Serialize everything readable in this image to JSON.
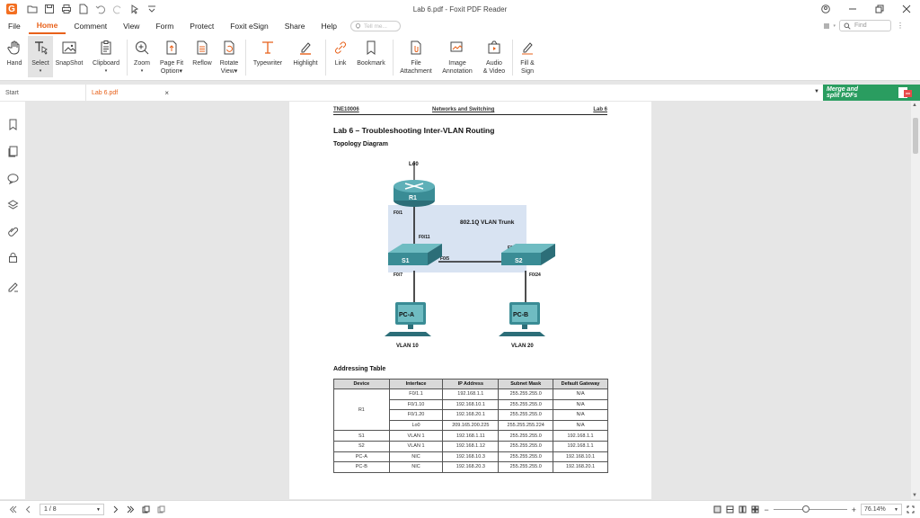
{
  "window": {
    "title": "Lab 6.pdf - Foxit PDF Reader",
    "logo_letter": "G"
  },
  "menu": {
    "items": [
      "File",
      "Home",
      "Comment",
      "View",
      "Form",
      "Protect",
      "Foxit eSign",
      "Share",
      "Help"
    ],
    "active": "Home",
    "tell_me_placeholder": "Tell me...",
    "find_placeholder": "Find"
  },
  "ribbon": {
    "hand": "Hand",
    "select": "Select",
    "snapshot": "SnapShot",
    "clipboard": "Clipboard",
    "zoom": "Zoom",
    "page_fit": "Page Fit",
    "page_fit_2": "Option",
    "reflow": "Reflow",
    "rotate": "Rotate",
    "rotate_2": "View",
    "typewriter": "Typewriter",
    "highlight": "Highlight",
    "link": "Link",
    "bookmark": "Bookmark",
    "file_attachment": "File",
    "file_attachment_2": "Attachment",
    "image_annotation": "Image",
    "image_annotation_2": "Annotation",
    "audio_video": "Audio",
    "audio_video_2": "& Video",
    "fill_sign": "Fill &",
    "fill_sign_2": "Sign"
  },
  "tabs": {
    "start": "Start",
    "doc": "Lab 6.pdf",
    "close": "×"
  },
  "ad": {
    "line1": "Merge and",
    "line2": "split PDFs"
  },
  "document": {
    "header_left": "TNE10006",
    "header_center": "Networks and Switching",
    "header_right": "Lab 6",
    "title": "Lab 6 – Troubleshooting Inter-VLAN Routing",
    "topology_heading": "Topology Diagram",
    "addressing_heading": "Addressing Table",
    "topology": {
      "lo0": "Lo0",
      "r1": "R1",
      "r1_f01": "F0/1",
      "trunk": "802.1Q  VLAN Trunk",
      "s1_f011": "F0/11",
      "s2_f05": "F0/5",
      "s1_f05": "F0/5",
      "s1": "S1",
      "s2": "S2",
      "s1_f07": "F0/7",
      "s2_f024": "F0/24",
      "pca": "PC-A",
      "pcb": "PC-B",
      "vlan10": "VLAN 10",
      "vlan20": "VLAN 20"
    },
    "table": {
      "headers": [
        "Device",
        "Interface",
        "IP Address",
        "Subnet Mask",
        "Default Gateway"
      ],
      "r1_label": "R1",
      "r1_rows": [
        [
          "F0/1.1",
          "192.168.1.1",
          "255.255.255.0",
          "N/A"
        ],
        [
          "F0/1.10",
          "192.168.10.1",
          "255.255.255.0",
          "N/A"
        ],
        [
          "F0/1.20",
          "192.168.20.1",
          "255.255.255.0",
          "N/A"
        ],
        [
          "Lo0",
          "209.165.200.225",
          "255.255.255.224",
          "N/A"
        ]
      ],
      "other_rows": [
        [
          "S1",
          "VLAN 1",
          "192.168.1.11",
          "255.255.255.0",
          "192.168.1.1"
        ],
        [
          "S2",
          "VLAN 1",
          "192.168.1.12",
          "255.255.255.0",
          "192.168.1.1"
        ],
        [
          "PC-A",
          "NIC",
          "192.168.10.3",
          "255.255.255.0",
          "192.168.10.1"
        ],
        [
          "PC-B",
          "NIC",
          "192.168.20.3",
          "255.255.255.0",
          "192.168.20.1"
        ]
      ]
    }
  },
  "status": {
    "page": "1 / 8",
    "zoom": "76.14%",
    "zoom_fraction": 0.44
  },
  "colors": {
    "accent": "#e8611a",
    "ad_green": "#2a9d60",
    "device_teal": "#3a8c95"
  }
}
